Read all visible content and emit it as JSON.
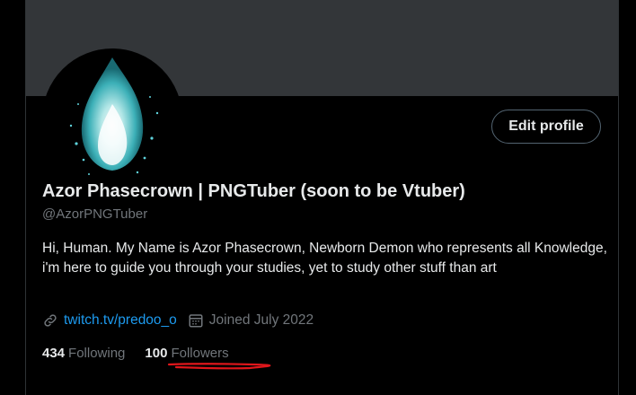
{
  "profile": {
    "display_name": "Azor Phasecrown | PNGTuber (soon to be Vtuber)",
    "handle": "@AzorPNGTuber",
    "bio": "Hi, Human. My Name is Azor Phasecrown, Newborn Demon who represents all Knowledge, i'm here to guide you through your studies, yet to study other stuff than art",
    "edit_button_label": "Edit profile",
    "website": "twitch.tv/predoo_o",
    "joined": "Joined July 2022",
    "following_count": "434",
    "following_label": "Following",
    "followers_count": "100",
    "followers_label": "Followers"
  },
  "icons": {
    "website": "link-icon",
    "joined": "calendar-icon"
  },
  "colors": {
    "background": "#000000",
    "banner": "#333639",
    "link": "#1d9bf0",
    "muted": "#71767b",
    "annotation": "#e0161b"
  }
}
